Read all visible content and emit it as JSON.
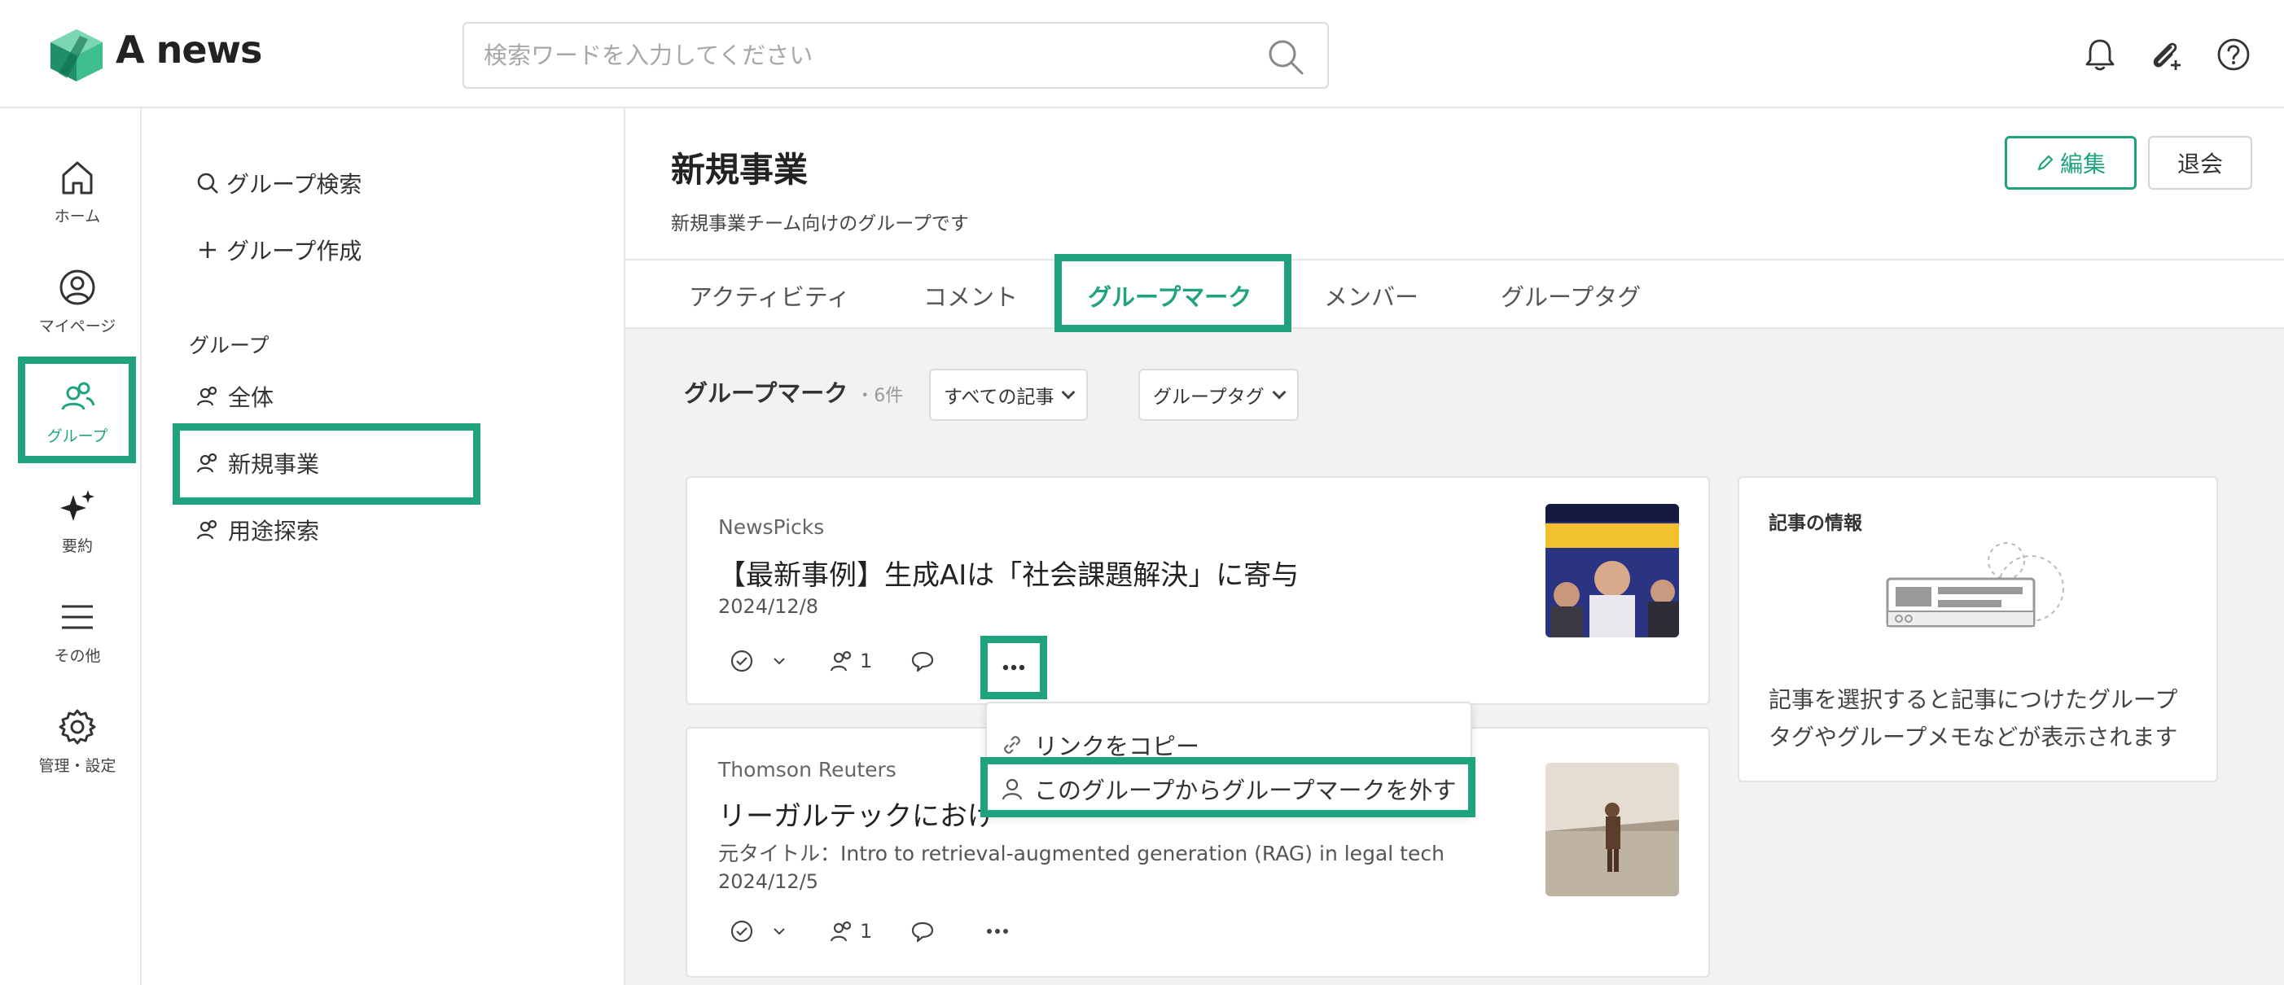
{
  "header": {
    "app_name": "A news",
    "search_placeholder": "検索ワードを入力してください"
  },
  "rail": {
    "items": [
      {
        "label": "ホーム",
        "icon": "home-icon"
      },
      {
        "label": "マイページ",
        "icon": "user-circle-icon"
      },
      {
        "label": "グループ",
        "icon": "group-icon"
      },
      {
        "label": "要約",
        "icon": "sparkle-icon"
      },
      {
        "label": "その他",
        "icon": "menu-icon"
      },
      {
        "label": "管理・設定",
        "icon": "gear-icon"
      }
    ]
  },
  "groups": {
    "search_label": "グループ検索",
    "create_label": "グループ作成",
    "heading": "グループ",
    "items": [
      "全体",
      "新規事業",
      "用途探索"
    ]
  },
  "main": {
    "title": "新規事業",
    "description": "新規事業チーム向けのグループです",
    "edit_label": "編集",
    "leave_label": "退会",
    "tabs": [
      "アクティビティ",
      "コメント",
      "グループマーク",
      "メンバー",
      "グループタグ"
    ],
    "list_title": "グループマーク",
    "list_count": "・6件",
    "filter_all": "すべての記事",
    "filter_tag": "グループタグ"
  },
  "articles": [
    {
      "source": "NewsPicks",
      "title": "【最新事例】生成AIは「社会課題解決」に寄与",
      "date": "2024/12/8",
      "members": "1"
    },
    {
      "source": "Thomson Reuters",
      "title": "リーガルテックにおけ",
      "orig_title": "元タイトル：Intro to retrieval-augmented generation (RAG) in legal tech",
      "date": "2024/12/5",
      "members": "1"
    }
  ],
  "menu": {
    "copy_link": "リンクをコピー",
    "remove_mark": "このグループからグループマークを外す"
  },
  "info_panel": {
    "title": "記事の情報",
    "text": "記事を選択すると記事につけたグループタグやグループメモなどが表示されます"
  },
  "colors": {
    "accent": "#1fa37f"
  }
}
